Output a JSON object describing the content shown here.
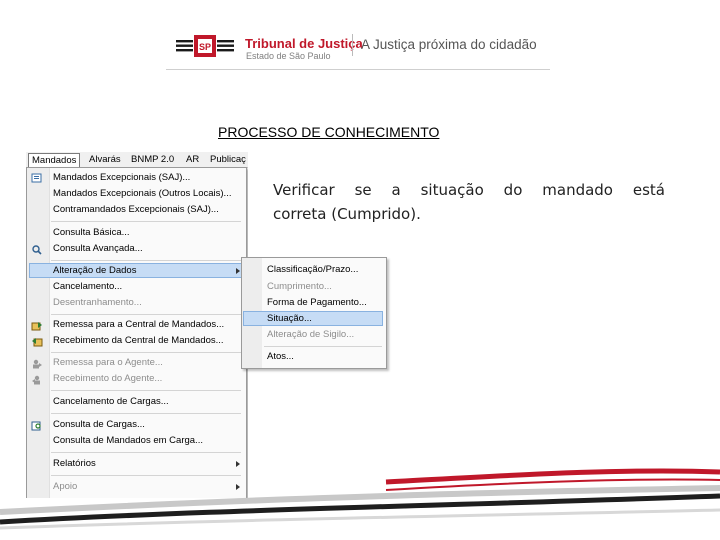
{
  "header": {
    "org_name": "Tribunal de Justiça",
    "org_sub": "Estado de São Paulo",
    "tagline": "A Justiça próxima do cidadão",
    "brand_color": "#c0182a"
  },
  "page": {
    "title": "PROCESSO DE CONHECIMENTO",
    "instruction_line1": "Verificar se a situação do mandado está",
    "instruction_line2": "correta (Cumprido)."
  },
  "menubar": {
    "items": [
      "Mandados",
      "Alvarás",
      "BNMP 2.0",
      "AR",
      "Publicaç"
    ]
  },
  "menu": {
    "items": [
      {
        "label": "Mandados Excepcionais (SAJ)...",
        "enabled": true,
        "icon": "form-icon"
      },
      {
        "label": "Mandados Excepcionais (Outros Locais)...",
        "enabled": true
      },
      {
        "label": "Contramandados Excepcionais (SAJ)...",
        "enabled": true
      },
      {
        "label": "Consulta Básica...",
        "enabled": true
      },
      {
        "label": "Consulta Avançada...",
        "enabled": true,
        "icon": "search-icon"
      },
      {
        "label": "Alteração de Dados",
        "enabled": true,
        "submenu": true,
        "highlighted": true
      },
      {
        "label": "Cancelamento...",
        "enabled": true
      },
      {
        "label": "Desentranhamento...",
        "enabled": false
      },
      {
        "label": "Remessa para a Central de Mandados...",
        "enabled": true,
        "icon": "send-icon"
      },
      {
        "label": "Recebimento da Central de Mandados...",
        "enabled": true,
        "icon": "receive-icon"
      },
      {
        "label": "Remessa para o Agente...",
        "enabled": false,
        "icon": "send-agent-icon"
      },
      {
        "label": "Recebimento do Agente...",
        "enabled": false,
        "icon": "receive-agent-icon"
      },
      {
        "label": "Cancelamento de Cargas...",
        "enabled": true
      },
      {
        "label": "Consulta de Cargas...",
        "enabled": true,
        "icon": "cargo-search-icon"
      },
      {
        "label": "Consulta de Mandados em Carga...",
        "enabled": true
      },
      {
        "label": "Relatórios",
        "enabled": true,
        "submenu": true
      },
      {
        "label": "Apoio",
        "enabled": false,
        "submenu": true
      }
    ]
  },
  "submenu": {
    "items": [
      {
        "label": "Classificação/Prazo...",
        "enabled": true
      },
      {
        "label": "Cumprimento...",
        "enabled": false
      },
      {
        "label": "Forma de Pagamento...",
        "enabled": true
      },
      {
        "label": "Situação...",
        "enabled": true,
        "highlighted": true
      },
      {
        "label": "Alteração de Sigilo...",
        "enabled": false
      },
      {
        "label": "Atos...",
        "enabled": true
      }
    ]
  }
}
